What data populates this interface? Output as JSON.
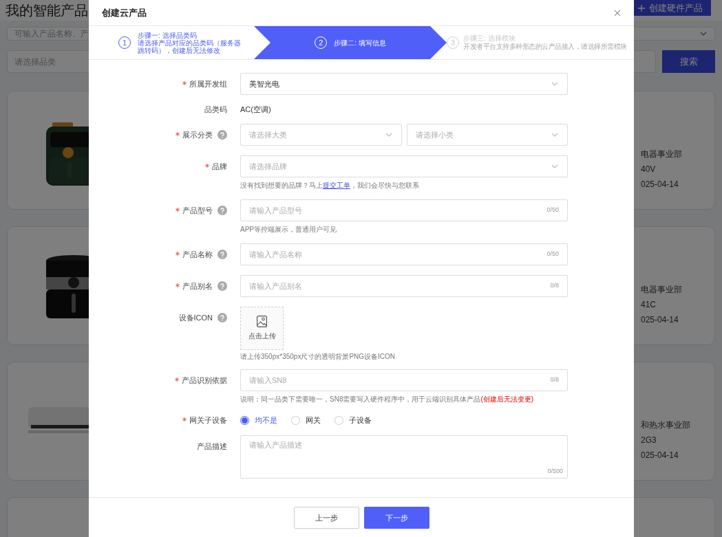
{
  "page": {
    "title": "我的智能产品",
    "create_button": "创建硬件产品",
    "search_placeholder": "可输入产品名称、产",
    "category_placeholder": "请选择品类",
    "search_button": "搜索",
    "cards": [
      {
        "kind": "fryer_green",
        "lines": [
          "电器事业部",
          "40V",
          "025-04-14"
        ]
      },
      {
        "kind": "fryer_black",
        "lines": [
          "电器事业部",
          "41C",
          "025-04-14"
        ]
      },
      {
        "kind": "aircon",
        "lines": [
          "和热水事业部",
          "2G3",
          "025-04-14"
        ]
      },
      {
        "kind": "empty"
      }
    ]
  },
  "dialog": {
    "title": "创建云产品",
    "steps": [
      {
        "number": "1",
        "title": "步骤一: 选择品类码",
        "description": "请选择产品对应的品类码（服务器跳转码），创建后无法修改",
        "completed": true,
        "active": false
      },
      {
        "number": "2",
        "title": "步骤二: 填写信息",
        "completed": false,
        "active": true
      },
      {
        "number": "3",
        "title": "步骤三: 选择模块",
        "description": "开发者平台支持多种形态的云产品接入，请选择所需模块",
        "completed": false,
        "active": false
      }
    ],
    "fields": [
      {
        "kind": "select",
        "label": "所属开发组",
        "required": true,
        "help": false,
        "value": "美智光电"
      },
      {
        "kind": "plain",
        "label": "品类码",
        "required": false,
        "help": false,
        "value": "AC(空调)"
      },
      {
        "kind": "two_selects",
        "label": "展示分类",
        "required": true,
        "help": true,
        "placeholders": [
          "请选择大类",
          "请选择小类"
        ]
      },
      {
        "kind": "select",
        "label": "品牌",
        "required": true,
        "help": false,
        "placeholder": "请选择品牌",
        "hint": "没有找到想要的品牌？马上",
        "hint_link": "提交工单",
        "hint_after": "，我们会尽快与您联系"
      },
      {
        "kind": "input",
        "label": "产品型号",
        "required": true,
        "help": true,
        "placeholder": "请输入产品型号",
        "counter": "0/50",
        "hint": "APP等控端展示，普通用户可见"
      },
      {
        "kind": "input",
        "label": "产品名称",
        "required": true,
        "help": true,
        "placeholder": "请输入产品名称",
        "counter": "0/50"
      },
      {
        "kind": "input",
        "label": "产品别名",
        "required": true,
        "help": true,
        "placeholder": "请输入产品别名",
        "counter": "0/8"
      },
      {
        "kind": "upload",
        "label": "设备ICON",
        "required": false,
        "help": true,
        "button": "点击上传",
        "hint": "请上传350px*350px尺寸的透明背景PNG设备ICON"
      },
      {
        "kind": "input",
        "label": "产品识别依据",
        "required": true,
        "help": false,
        "placeholder": "请输入SN8",
        "counter": "0/8",
        "hint": "说明：同一品类下需要唯一，SN8需要写入硬件程序中，用于云端识别具体产品",
        "hint_warning": "(创建后无法变更)"
      },
      {
        "kind": "radio",
        "label": "网关子设备",
        "required": true,
        "help": false,
        "options": [
          {
            "label": "均不是",
            "selected": true
          },
          {
            "label": "网关",
            "selected": false
          },
          {
            "label": "子设备",
            "selected": false
          }
        ]
      },
      {
        "kind": "textarea",
        "label": "产品描述",
        "required": false,
        "help": false,
        "placeholder": "请输入产品描述",
        "counter": "0/500"
      }
    ],
    "buttons": [
      {
        "label": "上一步",
        "kind": "secondary"
      },
      {
        "label": "下一步",
        "kind": "primary"
      }
    ]
  }
}
